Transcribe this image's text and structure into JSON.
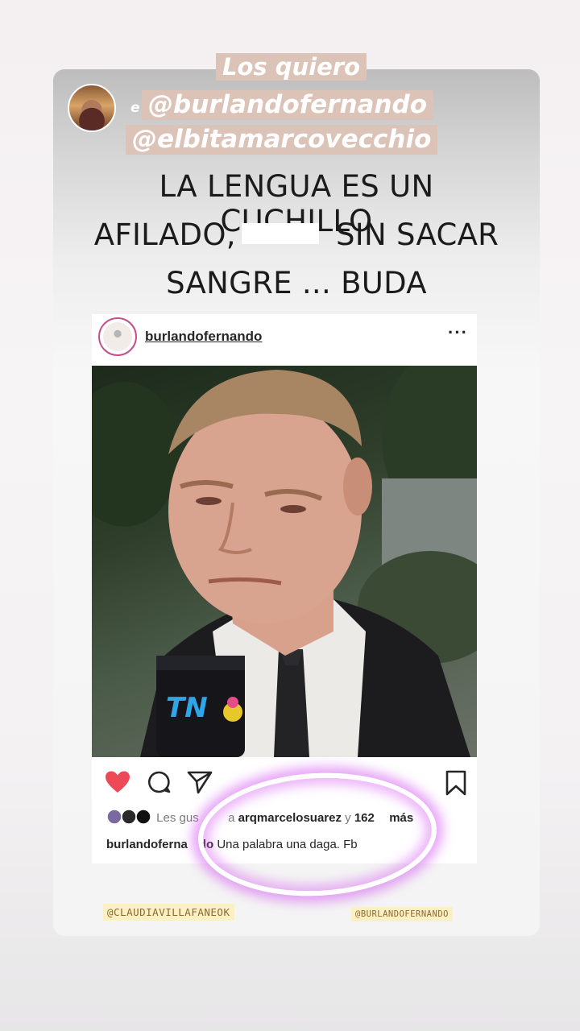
{
  "story": {
    "headline": "Los quiero",
    "prefix": "e",
    "mention_1": "@burlandofernando",
    "mention_2": "@elbitamarcovecchio",
    "quote_line_1": "LA LENGUA ES UN CUCHILLO",
    "quote_line_2a": "AFILADO,",
    "quote_line_2b": "SIN SACAR",
    "quote_line_3": "SANGRE ... BUDA",
    "tag_left": "@CLAUDIAVILLAFANEOK",
    "tag_right": "@BURLANDOFERNANDO"
  },
  "post": {
    "username": "burlandofernando",
    "more": "···",
    "microphone_logo": "TN",
    "likes_prefix": "Les gus",
    "likes_mid": "a",
    "likes_user": "arqmarcelosuarez",
    "likes_and": "y",
    "likes_count": "162",
    "likes_suffix": "más",
    "caption_user": "burlandoferna",
    "caption_user_end": "do",
    "caption_text": "Una palabra una daga. Fb"
  },
  "icons": [
    "heart-icon",
    "comment-icon",
    "share-icon",
    "bookmark-icon",
    "more-icon"
  ],
  "colors": {
    "heart": "#ed4956",
    "highlight_bg": "#dcc3b8",
    "circle_glow": "#d45af0",
    "story_ring": "#c44f8a"
  }
}
